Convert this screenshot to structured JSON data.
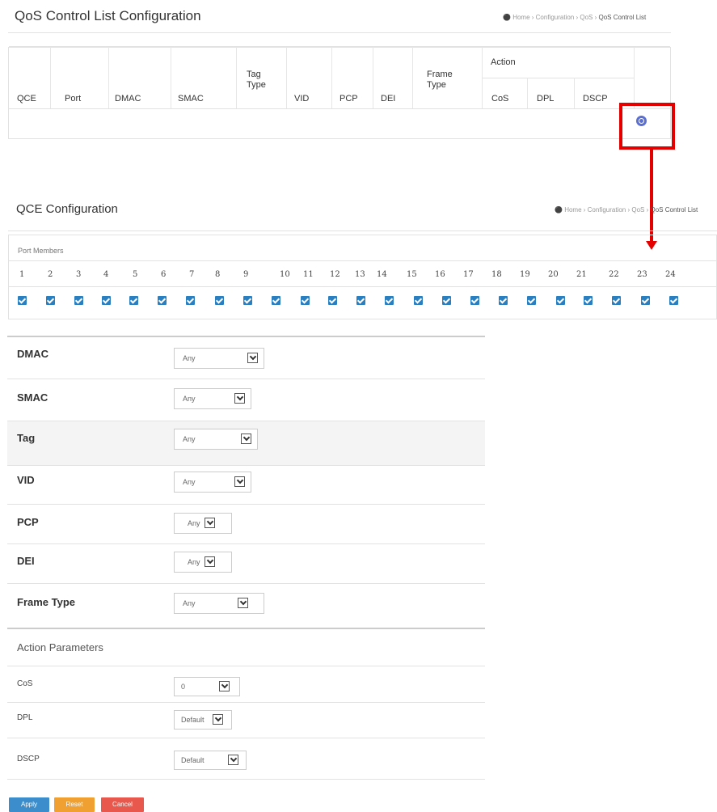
{
  "list": {
    "title": "QoS Control List Configuration",
    "breadcrumb": [
      "Home",
      "Configuration",
      "QoS",
      "QoS Control List"
    ],
    "columns": {
      "qce": "QCE",
      "port": "Port",
      "dmac": "DMAC",
      "smac": "SMAC",
      "tag_type_1": "Tag",
      "tag_type_2": "Type",
      "vid": "VID",
      "pcp": "PCP",
      "dei": "DEI",
      "frame_type_1": "Frame",
      "frame_type_2": "Type",
      "action": "Action",
      "cos": "CoS",
      "dpl": "DPL",
      "dscp": "DSCP"
    }
  },
  "config": {
    "title": "QCE Configuration",
    "breadcrumb": [
      "Home",
      "Configuration",
      "QoS",
      "QoS Control List"
    ],
    "port_members_label": "Port Members",
    "ports": [
      "1",
      "2",
      "3",
      "4",
      "5",
      "6",
      "7",
      "8",
      "9",
      "10",
      "11",
      "12",
      "13",
      "14",
      "15",
      "16",
      "17",
      "18",
      "19",
      "20",
      "21",
      "22",
      "23",
      "24"
    ],
    "fields": {
      "dmac": {
        "label": "DMAC",
        "value": "Any"
      },
      "smac": {
        "label": "SMAC",
        "value": "Any"
      },
      "tag": {
        "label": "Tag",
        "value": "Any"
      },
      "vid": {
        "label": "VID",
        "value": "Any"
      },
      "pcp": {
        "label": "PCP",
        "value": "Any"
      },
      "dei": {
        "label": "DEI",
        "value": "Any"
      },
      "frame_type": {
        "label": "Frame Type",
        "value": "Any"
      }
    },
    "action_params_title": "Action Parameters",
    "actions": {
      "cos": {
        "label": "CoS",
        "value": "0"
      },
      "dpl": {
        "label": "DPL",
        "value": "Default"
      },
      "dscp": {
        "label": "DSCP",
        "value": "Default"
      }
    }
  },
  "buttons": {
    "apply": "Apply",
    "reset": "Reset",
    "cancel": "Cancel"
  },
  "colors": {
    "accent_red": "#e50000",
    "checkbox": "#2a7fc1",
    "apply": "#3c8dcb",
    "reset": "#f0a030",
    "cancel": "#e8584c"
  }
}
